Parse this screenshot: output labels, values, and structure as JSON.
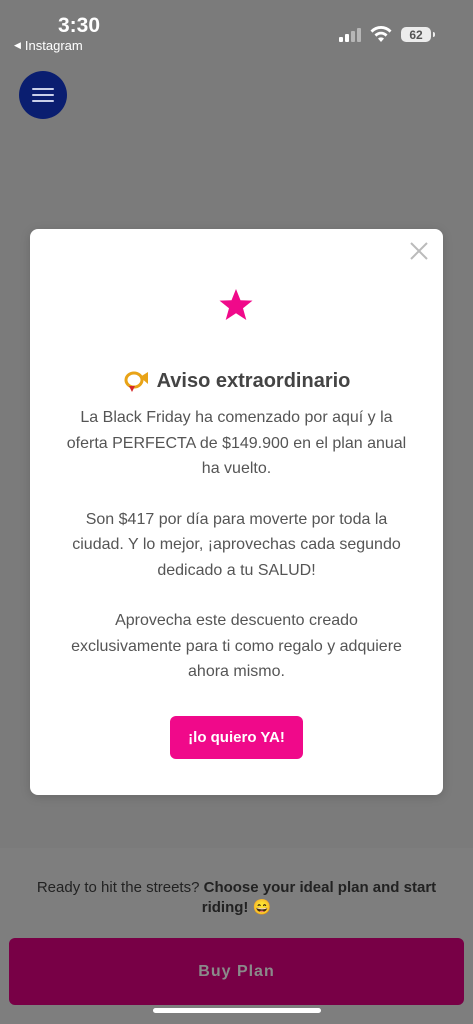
{
  "status_bar": {
    "time": "3:30",
    "back_app": "Instagram",
    "back_glyph": "◀",
    "battery": "62"
  },
  "menu": {
    "icon": "hamburger-icon",
    "color": "#0a1e70"
  },
  "modal": {
    "close_icon": "close-icon",
    "star_icon": "star-icon",
    "star_color": "#f0098a",
    "title_icon": "postal-horn-icon",
    "title": "Aviso extraordinario",
    "paragraphs": [
      "La Black Friday ha comenzado por aquí y la oferta PERFECTA de $149.900 en el plan anual ha vuelto.",
      "Son $417 por día para moverte por toda la ciudad. Y lo mejor, ¡aprovechas cada segundo dedicado a tu SALUD!",
      "Aprovecha este descuento creado exclusivamente para ti como regalo y adquiere ahora mismo."
    ],
    "cta_label": "¡lo quiero YA!",
    "cta_color": "#f0098a"
  },
  "bottom": {
    "ready_prefix": "Ready to hit the streets? ",
    "ready_bold": "Choose your ideal plan and start riding!",
    "ready_emoji": "😄",
    "buy_label": "Buy Plan",
    "buy_color": "#780046"
  }
}
